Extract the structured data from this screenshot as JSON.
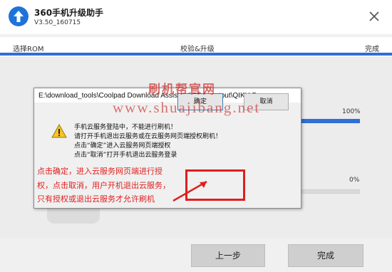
{
  "app": {
    "title": "360手机升级助手",
    "version": "V3.50_160715"
  },
  "steps": {
    "items": [
      "选择ROM",
      "校验&升级",
      "完成"
    ]
  },
  "progress": {
    "top_percent": "100%",
    "bottom_percent": "0%",
    "top_value": 1.0,
    "bottom_value": 0.0
  },
  "watermark": {
    "line1": "刷机帮官网",
    "line2": "www.shuajibang.net"
  },
  "dialog": {
    "title": "E:\\download_tools\\Coolpad Download Assistant\\QDA_output\\QIKU Dow...",
    "messages": [
      "手机云服务登陆中，不能进行刷机！",
      "请打开手机退出云服务或在云服务网页端授权刷机！",
      "点击“确定”进入云服务网页端授权",
      "点击“取消”打开手机退出云服务登录"
    ],
    "ok_label": "确定",
    "cancel_label": "取消"
  },
  "annotation": {
    "lines": [
      "点击确定，进入云服务网页端进行授",
      "权，点击取消，用户开机退出云服务，",
      "只有授权或退出云服务才允许刷机"
    ],
    "color": "#e01e1e"
  },
  "footer": {
    "prev_label": "上一步",
    "done_label": "完成"
  },
  "colors": {
    "accent": "#2f6fd6",
    "logo": "#1e73d8"
  }
}
